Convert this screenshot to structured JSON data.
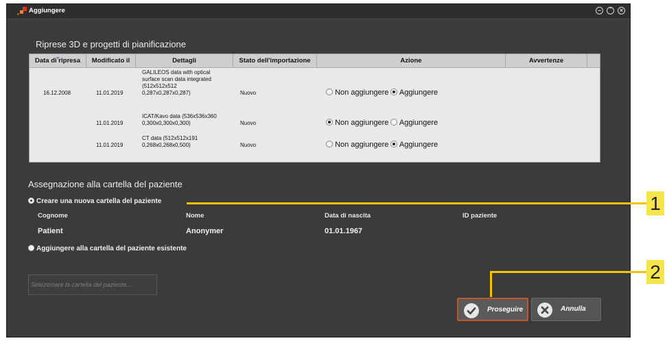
{
  "window": {
    "title": "Aggiungere"
  },
  "scans_section": {
    "title": "Riprese 3D e progetti di pianificazione",
    "columns": [
      "Data di ripresa",
      "Modificato il",
      "Dettagli",
      "Stato dell'importazione",
      "Azione",
      "Avvertenze"
    ],
    "rows": [
      {
        "date": "16.12.2008",
        "modified": "11.01.2019",
        "details_lines": [
          "GALILEOS data with optical",
          "surface scan data integrated",
          "(512x512x512",
          "0,287x0,287x0,287)"
        ],
        "status": "Nuovo",
        "option_no": "Non aggiungere",
        "option_yes": "Aggiungere",
        "selected": "Aggiungere"
      },
      {
        "date": "",
        "modified": "11.01.2019",
        "details_lines": [
          "ICAT/Kavo data (536x536x360",
          "0,300x0,300x0,300)"
        ],
        "status": "Nuovo",
        "option_no": "Non aggiungere",
        "option_yes": "Aggiungere",
        "selected": "Non aggiungere"
      },
      {
        "date": "",
        "modified": "11.01.2019",
        "details_lines": [
          "CT data (512x512x191",
          "0,268x0,268x0,500)"
        ],
        "status": "Nuovo",
        "option_no": "Non aggiungere",
        "option_yes": "Aggiungere",
        "selected": "Aggiungere"
      }
    ]
  },
  "patient_section": {
    "title": "Assegnazione alla cartella del paziente",
    "option_new": "Creare una nuova cartella del paziente",
    "option_existing": "Aggiungere alla cartella del paziente esistente",
    "selected": "option_new",
    "fields": {
      "surname_label": "Cognome",
      "name_label": "Nome",
      "birth_label": "Data di nascita",
      "id_label": "ID paziente",
      "surname": "Patient",
      "name": "Anonymer",
      "birth": "01.01.1967",
      "id": ""
    },
    "select_folder_label": "Selezionare la cartella del paziente..."
  },
  "buttons": {
    "continue": "Proseguire",
    "cancel": "Annulla"
  },
  "callouts": [
    "1",
    "2"
  ],
  "colors": {
    "window_bg": "#3b3b3b",
    "callout": "#f5e44a",
    "continue_border": "#c2572a"
  }
}
